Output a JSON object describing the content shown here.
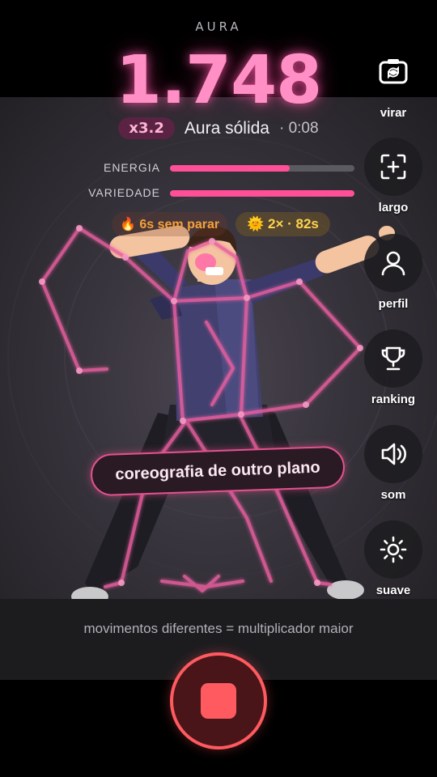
{
  "header": {
    "label": "AURA",
    "score": "1.748",
    "multiplier": "x3.2",
    "status": "Aura sólida",
    "timer": "· 0:08"
  },
  "meters": [
    {
      "label": "ENERGIA",
      "value": 0.65
    },
    {
      "label": "VARIEDADE",
      "value": 1.0
    }
  ],
  "chips": {
    "streak": "🔥 6s sem parar",
    "bonus": "🌞 2× · 82s"
  },
  "toolbar": [
    {
      "label": "virar",
      "icon": "flip-camera-icon"
    },
    {
      "label": "largo",
      "icon": "wide-frame-icon"
    },
    {
      "label": "perfil",
      "icon": "profile-icon"
    },
    {
      "label": "ranking",
      "icon": "trophy-icon"
    },
    {
      "label": "som",
      "icon": "speaker-icon"
    },
    {
      "label": "suave",
      "icon": "brightness-icon"
    }
  ],
  "callout": "coreografia de outro plano",
  "hint": "movimentos diferentes = multiplicador maior",
  "record": {
    "icon": "stop-icon"
  },
  "colors": {
    "accent": "#ff4f96",
    "score": "#ff8fc4",
    "record": "#ff5a60",
    "bonus": "#ffd34d"
  }
}
